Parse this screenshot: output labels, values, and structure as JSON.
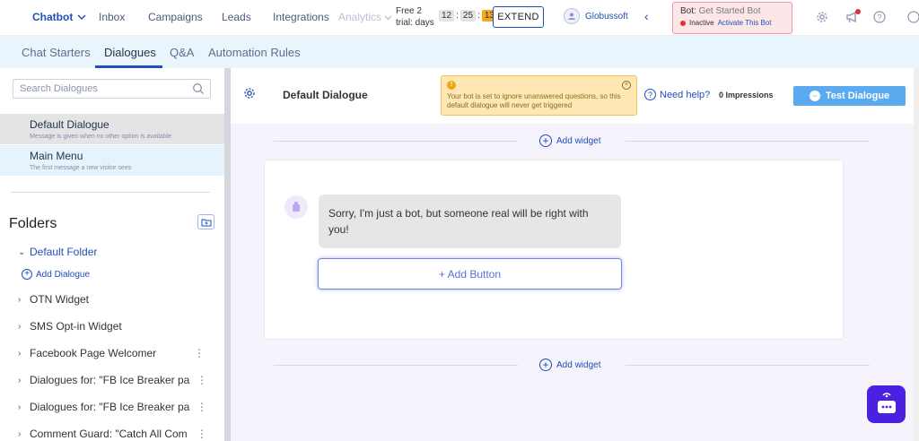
{
  "topnav": {
    "items": [
      {
        "label": "Chatbot",
        "active": true
      },
      {
        "label": "Inbox"
      },
      {
        "label": "Campaigns"
      },
      {
        "label": "Leads"
      },
      {
        "label": "Integrations"
      },
      {
        "label": "Analytics"
      }
    ],
    "trial": {
      "line1": "Free  2",
      "line2": "trial: days"
    },
    "timer": {
      "hours": "12",
      "minutes": "25",
      "seconds": "13"
    },
    "extend_label": "EXTEND",
    "org_name": "Globussoft",
    "collapse_icon": "chevron-left-icon",
    "bot_status": {
      "prefix": "Bot:",
      "bot_name": "Get Started Bot",
      "status": "Inactive",
      "activate_label": "Activate This Bot",
      "status_color": "#e0302f"
    },
    "icons": [
      "gear-icon",
      "megaphone-icon",
      "help-icon"
    ]
  },
  "subnav": {
    "tabs": [
      {
        "label": "Chat Starters"
      },
      {
        "label": "Dialogues",
        "active": true
      },
      {
        "label": "Q&A"
      },
      {
        "label": "Automation Rules"
      }
    ]
  },
  "sidebar": {
    "search_placeholder": "Search Dialogues",
    "dialogues": [
      {
        "title": "Default Dialogue",
        "subtitle": "Message is given when no other option is available",
        "selected": true
      },
      {
        "title": "Main Menu",
        "subtitle": "The first message a new visitor sees"
      }
    ],
    "folders_title": "Folders",
    "folders": [
      {
        "label": "Default Folder",
        "open": true
      },
      {
        "label": "OTN Widget"
      },
      {
        "label": "SMS Opt-in Widget"
      },
      {
        "label": "Facebook Page Welcomer"
      },
      {
        "label": "Dialogues for: \"FB Ice Breaker pa"
      },
      {
        "label": "Dialogues for: \"FB Ice Breaker pa"
      },
      {
        "label": "Comment Guard: \"Catch All Com"
      }
    ],
    "add_dialogue_label": "Add Dialogue"
  },
  "main": {
    "dialogue_title": "Default Dialogue",
    "warning": "Your bot is set to ignore unanswered questions, so this default dialogue will never get triggered",
    "help_label": "Need help?",
    "impressions_label": "0 Impressions",
    "test_button_label": "Test Dialogue",
    "add_widget_label": "Add widget",
    "bot_message": "Sorry, I'm just a bot, but someone real will be right with you!",
    "add_button_label": "+ Add Button"
  },
  "colors": {
    "accent": "#1f4fb8",
    "subnav_bg": "#e9f4fd",
    "test_button": "#5ba9ee",
    "warning_bg": "#fde8b4",
    "launcher": "#4a21e0"
  }
}
